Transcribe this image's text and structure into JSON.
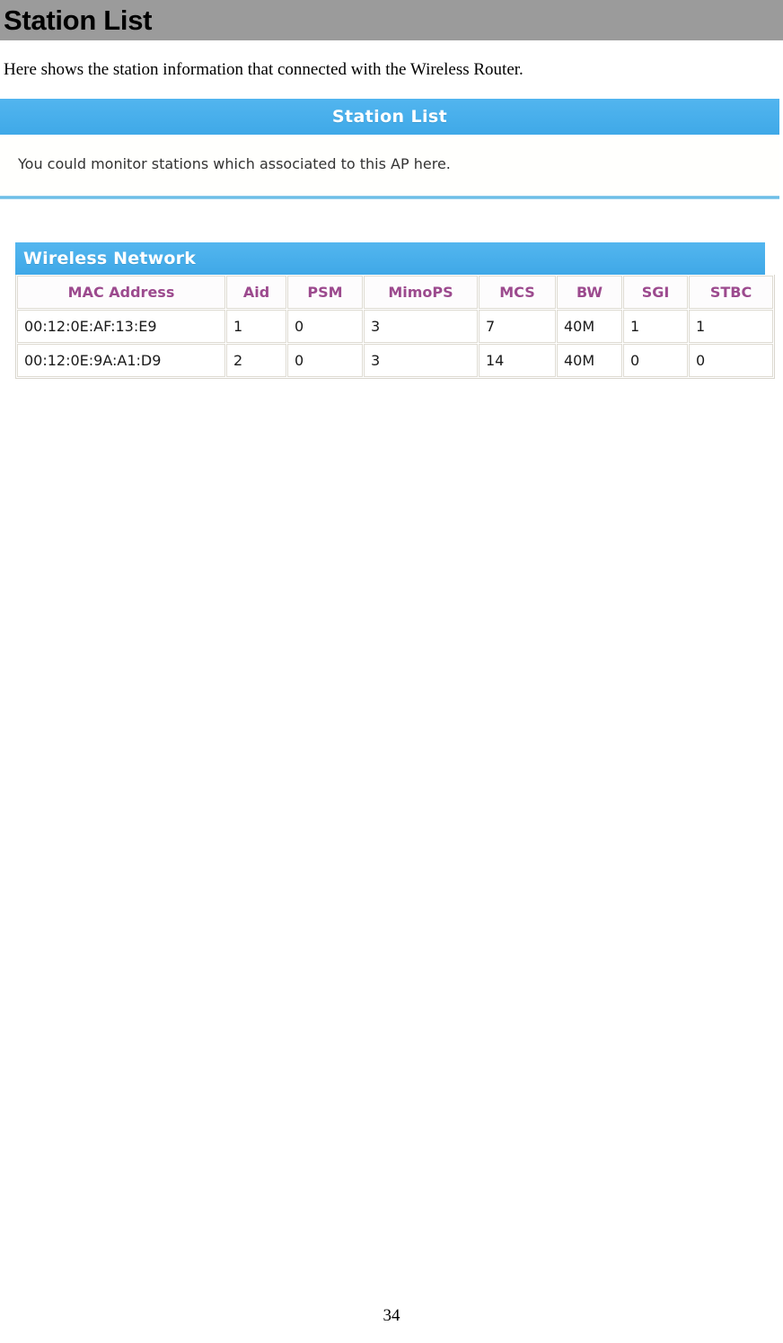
{
  "document": {
    "title": "Station List",
    "intro": "Here shows the station information that connected with the Wireless  Router.",
    "page_number": "34"
  },
  "router_ui": {
    "panel": {
      "banner_title": "Station List",
      "description": "You could monitor stations which associated to this AP here."
    },
    "table": {
      "banner_title": "Wireless Network",
      "columns": [
        "MAC Address",
        "Aid",
        "PSM",
        "MimoPS",
        "MCS",
        "BW",
        "SGI",
        "STBC"
      ],
      "rows": [
        {
          "mac_address": "00:12:0E:AF:13:E9",
          "aid": "1",
          "psm": "0",
          "mimops": "3",
          "mcs": "7",
          "bw": "40M",
          "sgi": "1",
          "stbc": "1"
        },
        {
          "mac_address": "00:12:0E:9A:A1:D9",
          "aid": "2",
          "psm": "0",
          "mimops": "3",
          "mcs": "14",
          "bw": "40M",
          "sgi": "0",
          "stbc": "0"
        }
      ]
    }
  },
  "colors": {
    "title_bar_gray": "#9b9b9b",
    "banner_blue": "#46aeec",
    "table_header_purple": "#9c4a8e",
    "rule_blue": "#5cb7e4"
  }
}
